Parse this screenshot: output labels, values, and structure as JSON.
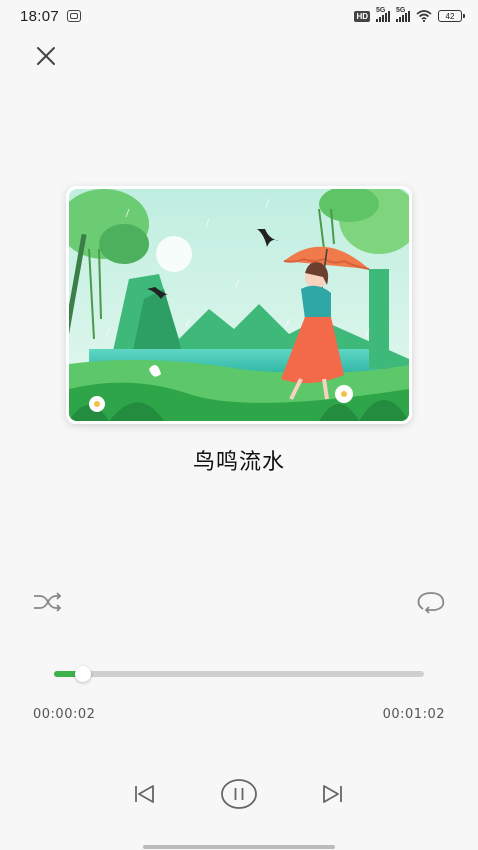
{
  "status_bar": {
    "time": "18:07",
    "hd": "HD",
    "signal_1_label": "5G",
    "signal_2_label": "5G",
    "battery": "42"
  },
  "player": {
    "title": "鸟鸣流水",
    "current_time": "00:00:02",
    "total_time": "00:01:02",
    "progress": 0.05,
    "accent_color": "#3db34a"
  },
  "icons": {
    "close": "close-icon",
    "shuffle": "shuffle-icon",
    "repeat": "repeat-icon",
    "previous": "skip-previous-icon",
    "pause": "pause-icon",
    "next": "skip-next-icon"
  }
}
